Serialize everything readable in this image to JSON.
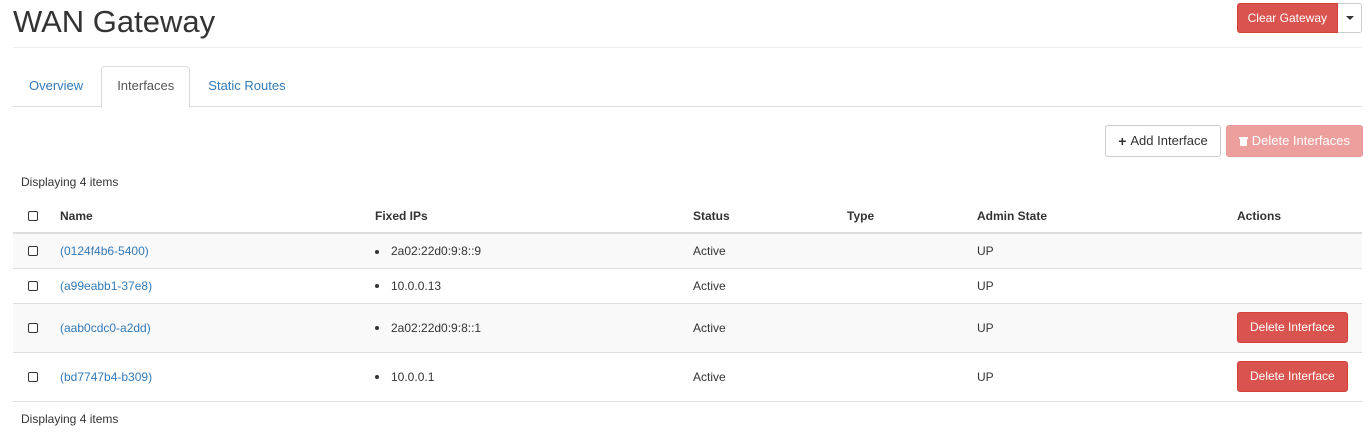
{
  "header": {
    "title": "WAN Gateway",
    "clear_gateway_label": "Clear Gateway"
  },
  "tabs": [
    {
      "label": "Overview",
      "active": false
    },
    {
      "label": "Interfaces",
      "active": true
    },
    {
      "label": "Static Routes",
      "active": false
    }
  ],
  "toolbar": {
    "add_label": "Add Interface",
    "delete_label": "Delete Interfaces"
  },
  "table": {
    "count_label": "Displaying 4 items",
    "columns": [
      "Name",
      "Fixed IPs",
      "Status",
      "Type",
      "Admin State",
      "Actions"
    ],
    "rows": [
      {
        "name": "(0124f4b6-5400)",
        "fixed_ip": "2a02:22d0:9:8::9",
        "status": "Active",
        "type": "",
        "admin_state": "UP",
        "action": ""
      },
      {
        "name": "(a99eabb1-37e8)",
        "fixed_ip": "10.0.0.13",
        "status": "Active",
        "type": "",
        "admin_state": "UP",
        "action": ""
      },
      {
        "name": "(aab0cdc0-a2dd)",
        "fixed_ip": "2a02:22d0:9:8::1",
        "status": "Active",
        "type": "",
        "admin_state": "UP",
        "action": "Delete Interface"
      },
      {
        "name": "(bd7747b4-b309)",
        "fixed_ip": "10.0.0.1",
        "status": "Active",
        "type": "",
        "admin_state": "UP",
        "action": "Delete Interface"
      }
    ]
  },
  "colors": {
    "danger": "#d9534f",
    "link": "#337ab7",
    "danger_disabled": "#ec9f9d"
  }
}
